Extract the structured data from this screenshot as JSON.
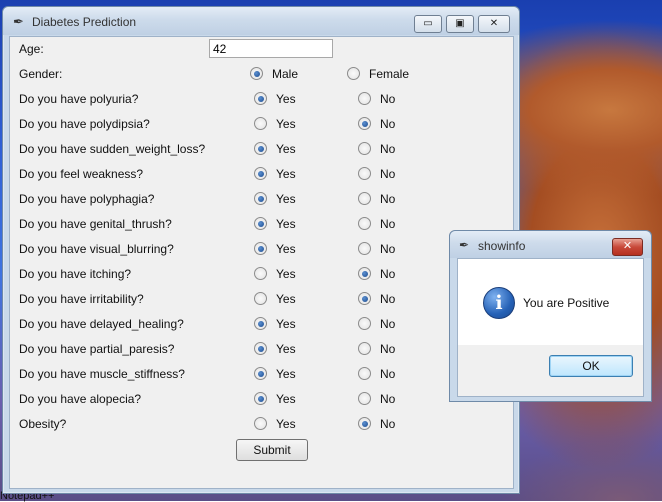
{
  "window": {
    "title": "Diabetes Prediction",
    "icon": "feather-icon",
    "controls": {
      "minimize": "▭",
      "maximize": "▣",
      "close": "✕"
    }
  },
  "form": {
    "age_label": "Age:",
    "age_value": "42",
    "gender_label": "Gender:",
    "male_label": "Male",
    "female_label": "Female",
    "gender_selected": "Male",
    "yes_label": "Yes",
    "no_label": "No",
    "questions": [
      {
        "text": "Do you have polyuria?",
        "selected": "Yes"
      },
      {
        "text": "Do you have polydipsia?",
        "selected": "No"
      },
      {
        "text": "Do you have sudden_weight_loss?",
        "selected": "Yes"
      },
      {
        "text": "Do you feel weakness?",
        "selected": "Yes"
      },
      {
        "text": "Do you have polyphagia?",
        "selected": "Yes"
      },
      {
        "text": "Do you have genital_thrush?",
        "selected": "Yes"
      },
      {
        "text": " Do you have visual_blurring?",
        "selected": "Yes"
      },
      {
        "text": "Do you have itching?",
        "selected": "No"
      },
      {
        "text": "Do you have irritability?",
        "selected": "No"
      },
      {
        "text": "Do you have delayed_healing?",
        "selected": "Yes"
      },
      {
        "text": "Do you have partial_paresis?",
        "selected": "Yes"
      },
      {
        "text": "Do you have muscle_stiffness?",
        "selected": "Yes"
      },
      {
        "text": "Do you have alopecia?",
        "selected": "Yes"
      },
      {
        "text": "Obesity?",
        "selected": "No"
      }
    ],
    "submit_label": "Submit"
  },
  "dialog": {
    "title": "showinfo",
    "icon": "feather-icon",
    "close": "✕",
    "message_icon": "info-icon",
    "message": "You are Positive",
    "ok_label": "OK"
  },
  "taskbar": {
    "label": "Notepad++"
  }
}
